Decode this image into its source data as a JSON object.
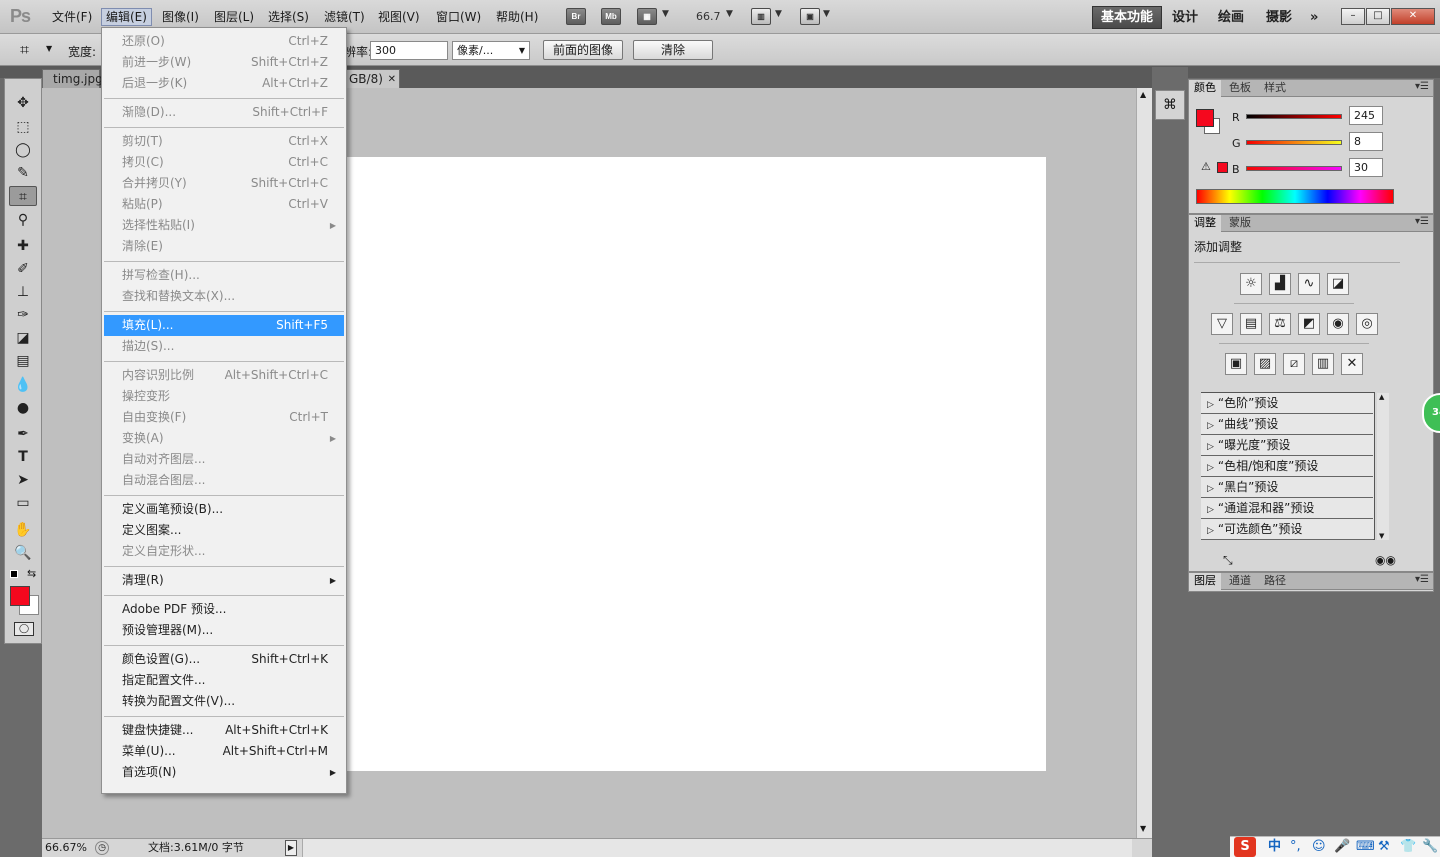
{
  "app": {
    "logo": "Ps"
  },
  "menubar": {
    "items": [
      "文件(F)",
      "编辑(E)",
      "图像(I)",
      "图层(L)",
      "选择(S)",
      "滤镜(T)",
      "视图(V)",
      "窗口(W)",
      "帮助(H)"
    ],
    "bridge_label": "Br",
    "minibridge_label": "Mb",
    "zoom": "66.7",
    "workspaces": [
      "基本功能",
      "设计",
      "绘画",
      "摄影"
    ],
    "more": "»",
    "window_controls": {
      "minimize": "–",
      "restore": "□",
      "close": "✕"
    }
  },
  "options": {
    "width_label": "宽度:",
    "resolution_label": "辨率:",
    "resolution_value": "300",
    "unit_value": "像素/...",
    "front_image_button": "前面的图像",
    "clear_button": "清除"
  },
  "document": {
    "tab_name": "timg.jpg",
    "tab_mode": "GB/8)",
    "tab_close": "✕",
    "zoom_status": "66.67%",
    "doc_info": "文档:3.61M/0 字节"
  },
  "edit_menu": {
    "groups": [
      [
        {
          "label": "还原(O)",
          "shortcut": "Ctrl+Z",
          "enabled": false
        },
        {
          "label": "前进一步(W)",
          "shortcut": "Shift+Ctrl+Z",
          "enabled": false
        },
        {
          "label": "后退一步(K)",
          "shortcut": "Alt+Ctrl+Z",
          "enabled": false
        }
      ],
      [
        {
          "label": "渐隐(D)...",
          "shortcut": "Shift+Ctrl+F",
          "enabled": false
        }
      ],
      [
        {
          "label": "剪切(T)",
          "shortcut": "Ctrl+X",
          "enabled": false
        },
        {
          "label": "拷贝(C)",
          "shortcut": "Ctrl+C",
          "enabled": false
        },
        {
          "label": "合并拷贝(Y)",
          "shortcut": "Shift+Ctrl+C",
          "enabled": false
        },
        {
          "label": "粘贴(P)",
          "shortcut": "Ctrl+V",
          "enabled": false
        },
        {
          "label": "选择性粘贴(I)",
          "shortcut": "",
          "enabled": false,
          "submenu": true
        },
        {
          "label": "清除(E)",
          "shortcut": "",
          "enabled": false
        }
      ],
      [
        {
          "label": "拼写检查(H)...",
          "shortcut": "",
          "enabled": false
        },
        {
          "label": "查找和替换文本(X)...",
          "shortcut": "",
          "enabled": false
        }
      ],
      [
        {
          "label": "填充(L)...",
          "shortcut": "Shift+F5",
          "enabled": true,
          "highlighted": true
        },
        {
          "label": "描边(S)...",
          "shortcut": "",
          "enabled": false
        }
      ],
      [
        {
          "label": "内容识别比例",
          "shortcut": "Alt+Shift+Ctrl+C",
          "enabled": false
        },
        {
          "label": "操控变形",
          "shortcut": "",
          "enabled": false
        },
        {
          "label": "自由变换(F)",
          "shortcut": "Ctrl+T",
          "enabled": false
        },
        {
          "label": "变换(A)",
          "shortcut": "",
          "enabled": false,
          "submenu": true
        },
        {
          "label": "自动对齐图层...",
          "shortcut": "",
          "enabled": false
        },
        {
          "label": "自动混合图层...",
          "shortcut": "",
          "enabled": false
        }
      ],
      [
        {
          "label": "定义画笔预设(B)...",
          "shortcut": "",
          "enabled": true
        },
        {
          "label": "定义图案...",
          "shortcut": "",
          "enabled": true
        },
        {
          "label": "定义自定形状...",
          "shortcut": "",
          "enabled": false
        }
      ],
      [
        {
          "label": "清理(R)",
          "shortcut": "",
          "enabled": true,
          "submenu": true
        }
      ],
      [
        {
          "label": "Adobe PDF 预设...",
          "shortcut": "",
          "enabled": true
        },
        {
          "label": "预设管理器(M)...",
          "shortcut": "",
          "enabled": true
        }
      ],
      [
        {
          "label": "颜色设置(G)...",
          "shortcut": "Shift+Ctrl+K",
          "enabled": true
        },
        {
          "label": "指定配置文件...",
          "shortcut": "",
          "enabled": true
        },
        {
          "label": "转换为配置文件(V)...",
          "shortcut": "",
          "enabled": true
        }
      ],
      [
        {
          "label": "键盘快捷键...",
          "shortcut": "Alt+Shift+Ctrl+K",
          "enabled": true
        },
        {
          "label": "菜单(U)...",
          "shortcut": "Alt+Shift+Ctrl+M",
          "enabled": true
        },
        {
          "label": "首选项(N)",
          "shortcut": "",
          "enabled": true,
          "submenu": true
        }
      ]
    ]
  },
  "color_panel": {
    "tabs": [
      "颜色",
      "色板",
      "样式"
    ],
    "r_label": "R",
    "g_label": "G",
    "b_label": "B",
    "r_value": "245",
    "g_value": "8",
    "b_value": "30",
    "foreground_color": "#f5081e",
    "background_color": "#ffffff"
  },
  "adjust_panel": {
    "tabs": [
      "调整",
      "蒙版"
    ],
    "heading": "添加调整",
    "presets": [
      "“色阶”预设",
      "“曲线”预设",
      "“曝光度”预设",
      "“色相/饱和度”预设",
      "“黑白”预设",
      "“通道混和器”预设",
      "“可选颜色”预设"
    ]
  },
  "layers_panel": {
    "tabs": [
      "图层",
      "通道",
      "路径"
    ]
  },
  "tray": {
    "ime": "中",
    "badge": "34"
  },
  "colors": {
    "menu_highlight": "#3399ff",
    "workspace_active": "#4a4a4a",
    "canvas": "#ffffff",
    "workspace_bg": "#bfbfbf"
  }
}
